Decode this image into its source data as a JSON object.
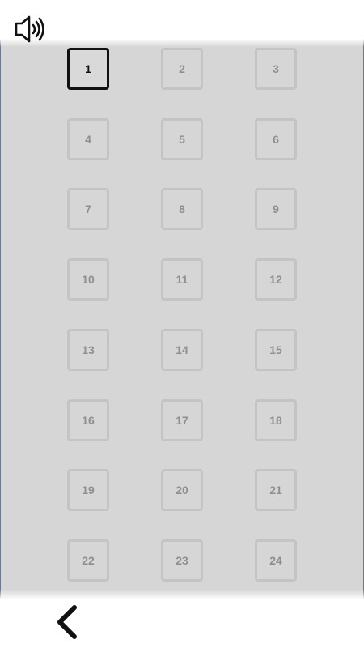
{
  "header": {
    "sound_icon": "speaker-on-icon"
  },
  "levels": [
    {
      "label": "1",
      "state": "current"
    },
    {
      "label": "2",
      "state": "locked"
    },
    {
      "label": "3",
      "state": "locked"
    },
    {
      "label": "4",
      "state": "locked"
    },
    {
      "label": "5",
      "state": "locked"
    },
    {
      "label": "6",
      "state": "locked"
    },
    {
      "label": "7",
      "state": "locked"
    },
    {
      "label": "8",
      "state": "locked"
    },
    {
      "label": "9",
      "state": "locked"
    },
    {
      "label": "10",
      "state": "locked"
    },
    {
      "label": "11",
      "state": "locked"
    },
    {
      "label": "12",
      "state": "locked"
    },
    {
      "label": "13",
      "state": "locked"
    },
    {
      "label": "14",
      "state": "locked"
    },
    {
      "label": "15",
      "state": "locked"
    },
    {
      "label": "16",
      "state": "locked"
    },
    {
      "label": "17",
      "state": "locked"
    },
    {
      "label": "18",
      "state": "locked"
    },
    {
      "label": "19",
      "state": "locked"
    },
    {
      "label": "20",
      "state": "locked"
    },
    {
      "label": "21",
      "state": "locked"
    },
    {
      "label": "22",
      "state": "locked"
    },
    {
      "label": "23",
      "state": "locked"
    },
    {
      "label": "24",
      "state": "locked"
    }
  ],
  "footer": {
    "back_icon": "chevron-left-icon"
  },
  "colors": {
    "panel": "#d6d6d6",
    "locked_border": "#c4c4c4",
    "locked_text": "#8f8f8f",
    "current_border": "#111111"
  }
}
